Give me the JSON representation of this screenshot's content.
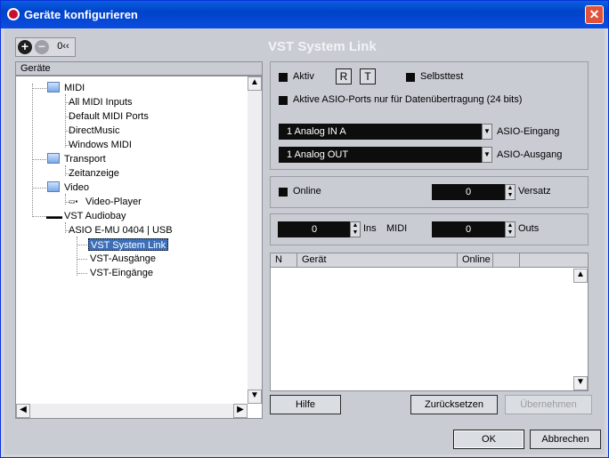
{
  "window": {
    "title": "Geräte konfigurieren",
    "close_label": "✕"
  },
  "panel": {
    "title": "VST System Link"
  },
  "toolbar": {
    "add_label": "+",
    "remove_label": "−",
    "reset_label": "0‹‹"
  },
  "tree": {
    "header": "Geräte",
    "items": [
      {
        "label": "MIDI"
      },
      {
        "label": "All MIDI Inputs"
      },
      {
        "label": "Default MIDI Ports"
      },
      {
        "label": "DirectMusic"
      },
      {
        "label": "Windows MIDI"
      },
      {
        "label": "Transport"
      },
      {
        "label": "Zeitanzeige"
      },
      {
        "label": "Video"
      },
      {
        "label": "Video-Player"
      },
      {
        "label": "VST Audiobay"
      },
      {
        "label": "ASIO E-MU 0404 | USB"
      },
      {
        "label": "VST System Link"
      },
      {
        "label": "VST-Ausgänge"
      },
      {
        "label": "VST-Eingänge"
      }
    ]
  },
  "settings": {
    "aktiv_label": "Aktiv",
    "r_label": "R",
    "t_label": "T",
    "selbsttest_label": "Selbsttest",
    "asio_ports_label": "Aktive ASIO-Ports nur für Datenübertragung (24 bits)",
    "asio_input_value": "1 Analog IN A",
    "asio_input_label": "ASIO-Eingang",
    "asio_output_value": "1 Analog OUT",
    "asio_output_label": "ASIO-Ausgang",
    "online_label": "Online",
    "versatz_value": "0",
    "versatz_label": "Versatz",
    "ins_value": "0",
    "ins_label": "Ins",
    "midi_label": "MIDI",
    "outs_value": "0",
    "outs_label": "Outs"
  },
  "list": {
    "columns": [
      "N",
      "Gerät",
      "Online"
    ]
  },
  "buttons": {
    "hilfe": "Hilfe",
    "zuruecksetzen": "Zurücksetzen",
    "uebernehmen": "Übernehmen",
    "ok": "OK",
    "abbrechen": "Abbrechen"
  }
}
